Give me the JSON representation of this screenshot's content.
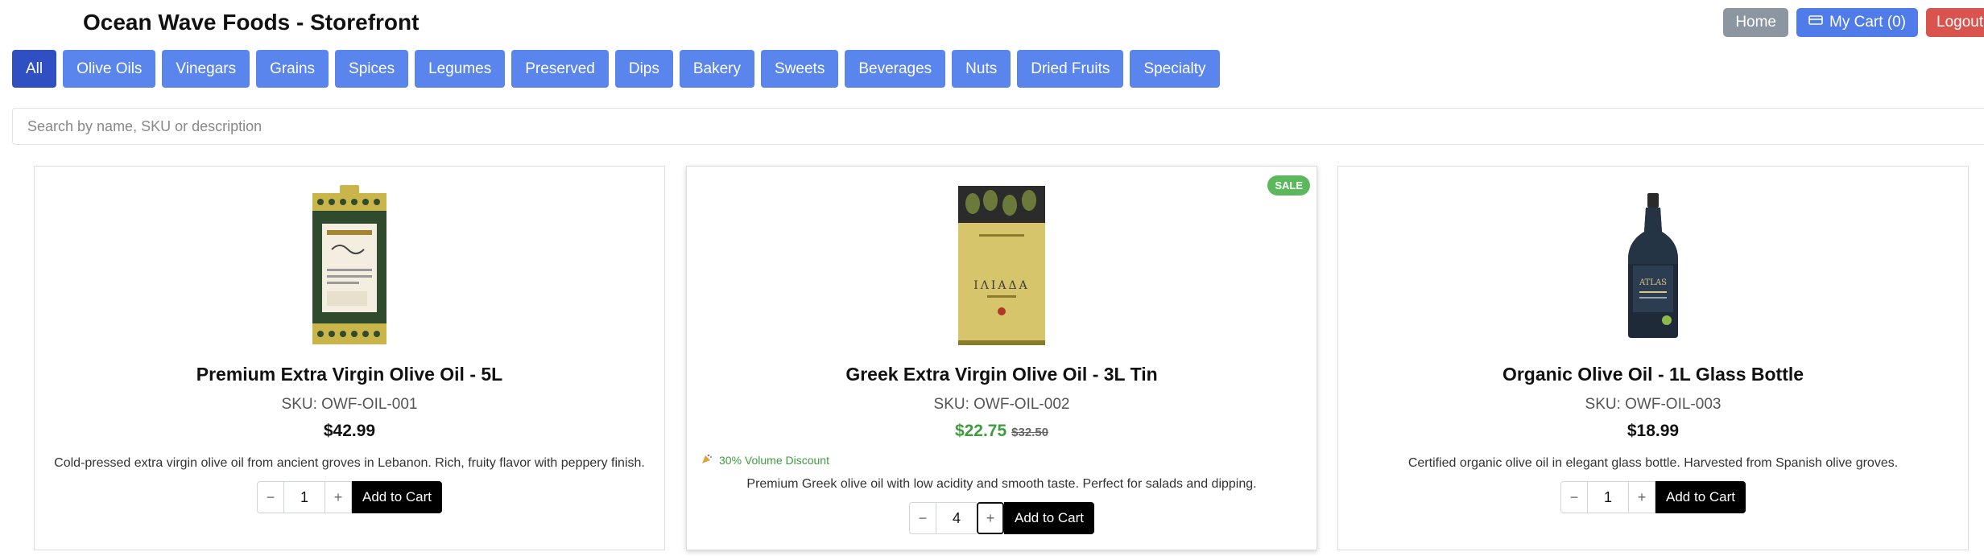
{
  "header": {
    "title": "Ocean Wave Foods - Storefront",
    "home_label": "Home",
    "cart_label": "My Cart (0)",
    "cart_icon": "cart-icon",
    "logout_label": "Logout"
  },
  "categories": [
    "All",
    "Olive Oils",
    "Vinegars",
    "Grains",
    "Spices",
    "Legumes",
    "Preserved",
    "Dips",
    "Bakery",
    "Sweets",
    "Beverages",
    "Nuts",
    "Dried Fruits",
    "Specialty"
  ],
  "active_category": "All",
  "search": {
    "placeholder": "Search by name, SKU or description",
    "value": ""
  },
  "products": [
    {
      "name": "Premium Extra Virgin Olive Oil - 5L",
      "sku": "SKU: OWF-OIL-001",
      "price": "$42.99",
      "description": "Cold-pressed extra virgin olive oil from ancient groves in Lebanon. Rich, fruity flavor with peppery finish.",
      "qty": "1",
      "add_label": "Add to Cart",
      "image": "olive-oil-tin-5l"
    },
    {
      "name": "Greek Extra Virgin Olive Oil - 3L Tin",
      "sku": "SKU: OWF-OIL-002",
      "price": "$22.75",
      "old_price": "$32.50",
      "badge": "SALE",
      "discount": "30% Volume Discount",
      "description": "Premium Greek olive oil with low acidity and smooth taste. Perfect for salads and dipping.",
      "qty": "4",
      "add_label": "Add to Cart",
      "image": "olive-oil-tin-3l"
    },
    {
      "name": "Organic Olive Oil - 1L Glass Bottle",
      "sku": "SKU: OWF-OIL-003",
      "price": "$18.99",
      "description": "Certified organic olive oil in elegant glass bottle. Harvested from Spanish olive groves.",
      "qty": "1",
      "add_label": "Add to Cart",
      "image": "olive-oil-bottle-1l"
    }
  ],
  "qty_controls": {
    "minus": "−",
    "plus": "+"
  },
  "colors": {
    "tab": "#5a85ec",
    "tab_active": "#2f4fc2",
    "sale": "#5cb85c",
    "sale_price": "#3f9b3f",
    "logout": "#d9534f",
    "home": "#8c96a0"
  }
}
